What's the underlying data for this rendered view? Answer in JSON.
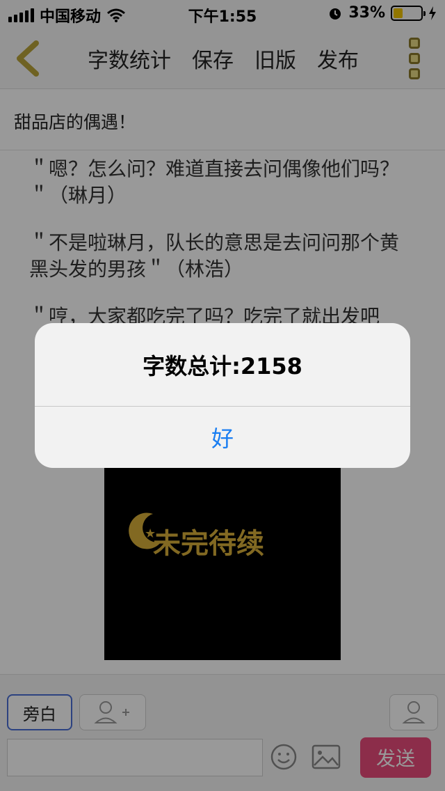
{
  "status_bar": {
    "carrier": "中国移动",
    "time": "下午1:55",
    "battery_percent": "33%",
    "battery_level": 0.33,
    "icons": [
      "signal-icon",
      "wifi-icon",
      "alarm-icon",
      "battery-icon",
      "charging-icon"
    ]
  },
  "nav": {
    "back_icon": "chevron-left-icon",
    "items": [
      "字数统计",
      "保存",
      "旧版",
      "发布"
    ],
    "more_icon": "more-vertical-icon"
  },
  "story": {
    "title": "甜品店的偶遇！",
    "paragraphs": [
      "＂嗯？怎么问？难道直接去问偶像他们吗？＂（琳月）",
      "＂不是啦琳月，队长的意思是去问问那个黄黑头发的男孩＂（林浩）",
      "＂哼，大家都吃完了吗？吃完了就出发吧"
    ],
    "image_caption": "未完待续"
  },
  "toolbar": {
    "narration_label": "旁白",
    "add_role_icon": "add-user-icon",
    "role_icon": "user-icon",
    "input_value": "",
    "emoji_icon": "emoji-icon",
    "image_icon": "image-icon",
    "send_label": "发送"
  },
  "alert": {
    "title": "字数总计:2158",
    "ok_label": "好"
  },
  "colors": {
    "send_button": "#ea4c7c",
    "alert_button_text": "#1a7ef2",
    "narration_border": "#4a6fd6",
    "battery_fill": "#f2c500"
  }
}
